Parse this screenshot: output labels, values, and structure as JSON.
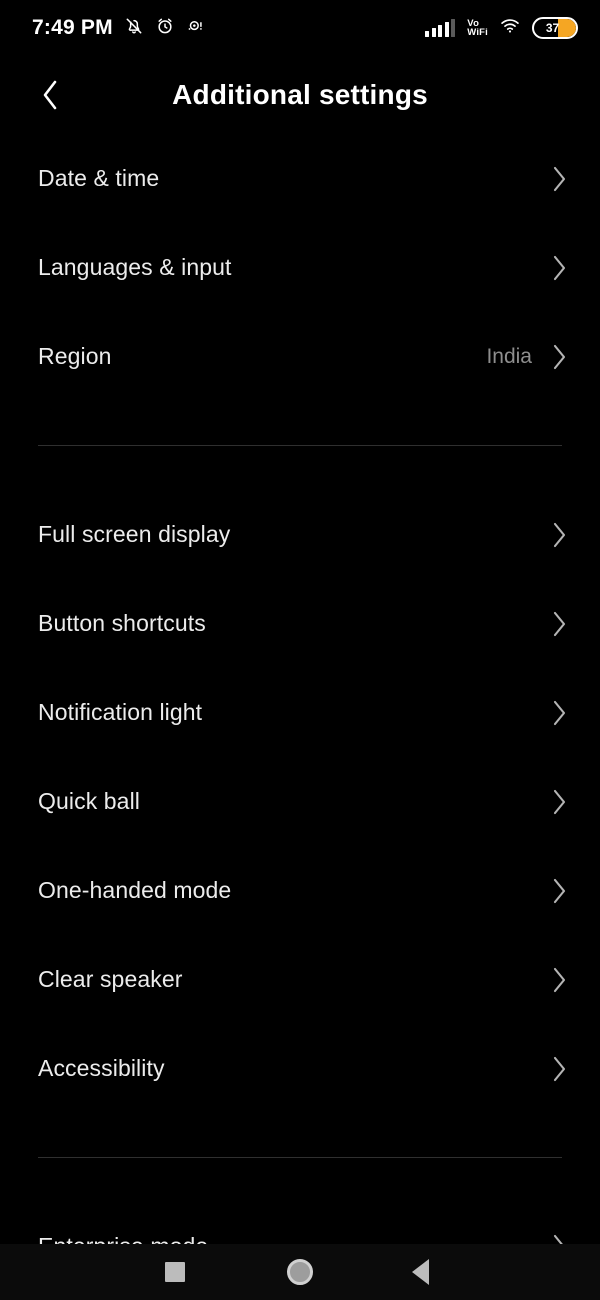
{
  "status_bar": {
    "clock": "7:49 PM",
    "left_icons": [
      {
        "name": "silent-mode-icon",
        "glyph": "bell-slash"
      },
      {
        "name": "alarm-clock-icon",
        "glyph": "alarm"
      },
      {
        "name": "data-saver-icon",
        "glyph": "dot-circle"
      }
    ],
    "signal": {
      "name": "cellular-signal-icon",
      "bars_filled": 4,
      "bars_total": 5
    },
    "vowifi": {
      "line1": "Vo",
      "line2": "WiFi"
    },
    "wifi": {
      "name": "wifi-icon"
    },
    "battery": {
      "level": "37",
      "fill_color": "#f5a623"
    }
  },
  "header": {
    "back_label": "‹",
    "title": "Additional settings"
  },
  "groups": [
    {
      "items": [
        {
          "label": "Date & time",
          "value": "",
          "name": "date-and-time"
        },
        {
          "label": "Languages & input",
          "value": "",
          "name": "languages-and-input"
        },
        {
          "label": "Region",
          "value": "India",
          "name": "region"
        }
      ]
    },
    {
      "items": [
        {
          "label": "Full screen display",
          "value": "",
          "name": "full-screen-display"
        },
        {
          "label": "Button shortcuts",
          "value": "",
          "name": "button-shortcuts"
        },
        {
          "label": "Notification light",
          "value": "",
          "name": "notification-light"
        },
        {
          "label": "Quick ball",
          "value": "",
          "name": "quick-ball"
        },
        {
          "label": "One-handed mode",
          "value": "",
          "name": "one-handed-mode"
        },
        {
          "label": "Clear speaker",
          "value": "",
          "name": "clear-speaker"
        },
        {
          "label": "Accessibility",
          "value": "",
          "name": "accessibility"
        }
      ]
    },
    {
      "items": [
        {
          "label": "Enterprise mode",
          "value": "",
          "name": "enterprise-mode"
        }
      ]
    }
  ],
  "nav_bar": {
    "recents": "recents-button",
    "home": "home-button",
    "back": "back-button"
  },
  "colors": {
    "background": "#000000",
    "text_primary": "#ececec",
    "text_secondary": "#8e8e8e",
    "divider": "#2f2f2f",
    "accent_battery": "#f5a623"
  }
}
